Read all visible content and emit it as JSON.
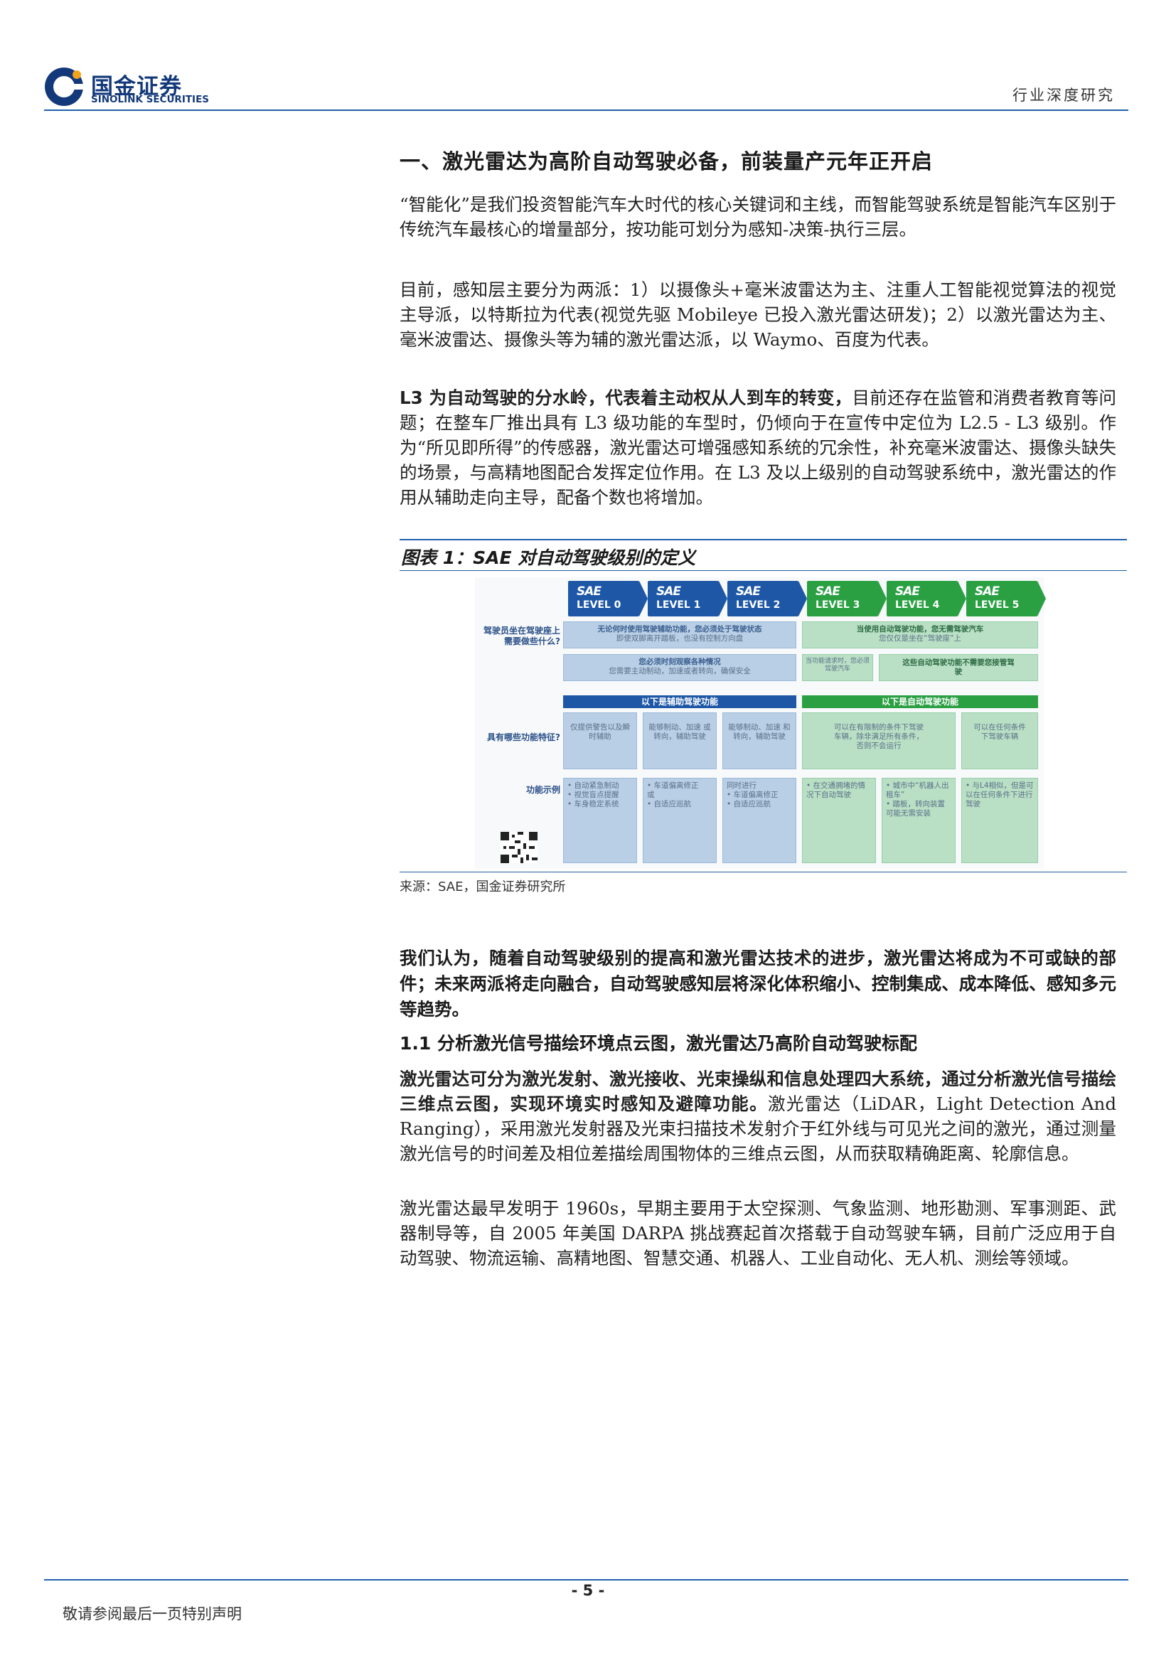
{
  "header": {
    "logo_cn": "国金证券",
    "logo_en": "SINOLINK SECURITIES",
    "report_type": "行业深度研究",
    "brand_color": "#13397a",
    "accent_color": "#1f5fa8"
  },
  "section1": {
    "title": "一、激光雷达为高阶自动驾驶必备，前装量产元年正开启",
    "p1": "“智能化”是我们投资智能汽车大时代的核心关键词和主线，而智能驾驶系统是智能汽车区别于传统汽车最核心的增量部分，按功能可划分为感知-决策-执行三层。",
    "p2": "目前，感知层主要分为两派：1）以摄像头+毫米波雷达为主、注重人工智能视觉算法的视觉主导派，以特斯拉为代表(视觉先驱 Mobileye 已投入激光雷达研发)；2）以激光雷达为主、毫米波雷达、摄像头等为辅的激光雷达派，以 Waymo、百度为代表。",
    "p3_bold": "L3 为自动驾驶的分水岭，代表着主动权从人到车的转变，",
    "p3_rest": "目前还存在监管和消费者教育等问题；在整车厂推出具有 L3 级功能的车型时，仍倾向于在宣传中定位为 L2.5 - L3 级别。作为“所见即所得”的传感器，激光雷达可增强感知系统的冗余性，补充毫米波雷达、摄像头缺失的场景，与高精地图配合发挥定位作用。在 L3 及以上级别的自动驾驶系统中，激光雷达的作用从辅助走向主导，配备个数也将增加。"
  },
  "figure": {
    "title": "图表 1：SAE 对自动驾驶级别的定义",
    "source": "来源：SAE，国金证券研究所",
    "levels": [
      {
        "sae": "SAE",
        "label": "LEVEL 0"
      },
      {
        "sae": "SAE",
        "label": "LEVEL 1"
      },
      {
        "sae": "SAE",
        "label": "LEVEL 2"
      },
      {
        "sae": "SAE",
        "label": "LEVEL 3"
      },
      {
        "sae": "SAE",
        "label": "LEVEL 4"
      },
      {
        "sae": "SAE",
        "label": "LEVEL 5"
      }
    ],
    "q1": "驾驶员坐在驾驶座上需要做些什么?",
    "q2": "具有哪些功能特征?",
    "q3": "功能示例",
    "blue_driver_top_title": "无论何时使用驾驶辅助功能，您必须处于驾驶状态",
    "blue_driver_top_sub": "即使双脚离开踏板，也没有控制方向盘",
    "blue_driver_bottom_title": "您必须时刻观察各种情况",
    "blue_driver_bottom_sub": "您需要主动制动，加速或者转向，确保安全",
    "green_driver_top_title": "当使用自动驾驶功能，您无需驾驶汽车",
    "green_driver_top_sub": "您仅仅是坐在“驾驶座”上",
    "green_driver_l3": "当功能请求时，您必须驾驶汽车",
    "green_driver_l45": "这些自动驾驶功能不需要您接管驾驶",
    "blue_header": "以下是辅助驾驶功能",
    "green_header": "以下是自动驾驶功能",
    "feat_l0": "仅提供警告以及瞬时辅助",
    "feat_l1": "能够制动、加速 或 转向，辅助驾驶",
    "feat_l2": "能够制动、加速 和 转向，辅助驾驶",
    "feat_l34": "可以在有限制的条件下驾驶车辆，除非满足所有条件，否则不会运行",
    "feat_l5": "可以在任何条件下驾驶车辆",
    "ex_l0": "• 自动紧急制动\n• 视觉盲点提醒\n• 车身稳定系统",
    "ex_l1": "• 车道偏离修正\n或\n• 自适应巡航",
    "ex_l2": "同时进行\n• 车道偏离修正\n• 自适应巡航",
    "ex_l3": "• 在交通拥堵的情况下自动驾驶",
    "ex_l4": "• 城市中“机器人出租车”\n• 踏板，转向装置可能无需安装",
    "ex_l5": "• 与L4相似，但是可以在任何条件下进行驾驶",
    "blue": "#1d57a6",
    "green": "#2aa043"
  },
  "after_figure": {
    "conclusion": "我们认为，随着自动驾驶级别的提高和激光雷达技术的进步，激光雷达将成为不可或缺的部件；未来两派将走向融合，自动驾驶感知层将深化体积缩小、控制集成、成本降低、感知多元等趋势。",
    "h2": "1.1 分析激光信号描绘环境点云图，激光雷达乃高阶自动驾驶标配",
    "p4_bold": "激光雷达可分为激光发射、激光接收、光束操纵和信息处理四大系统，通过分析激光信号描绘三维点云图，实现环境实时感知及避障功能。",
    "p4_rest": "激光雷达（LiDAR，Light Detection And Ranging），采用激光发射器及光束扫描技术发射介于红外线与可见光之间的激光，通过测量激光信号的时间差及相位差描绘周围物体的三维点云图，从而获取精确距离、轮廓信息。",
    "p5": "激光雷达最早发明于 1960s，早期主要用于太空探测、气象监测、地形勘测、军事测距、武器制导等，自 2005 年美国 DARPA 挑战赛起首次搭载于自动驾驶车辆，目前广泛应用于自动驾驶、物流运输、高精地图、智慧交通、机器人、工业自动化、无人机、测绘等领域。"
  },
  "footer": {
    "page": "- 5 -",
    "disclaimer": "敬请参阅最后一页特别声明"
  }
}
